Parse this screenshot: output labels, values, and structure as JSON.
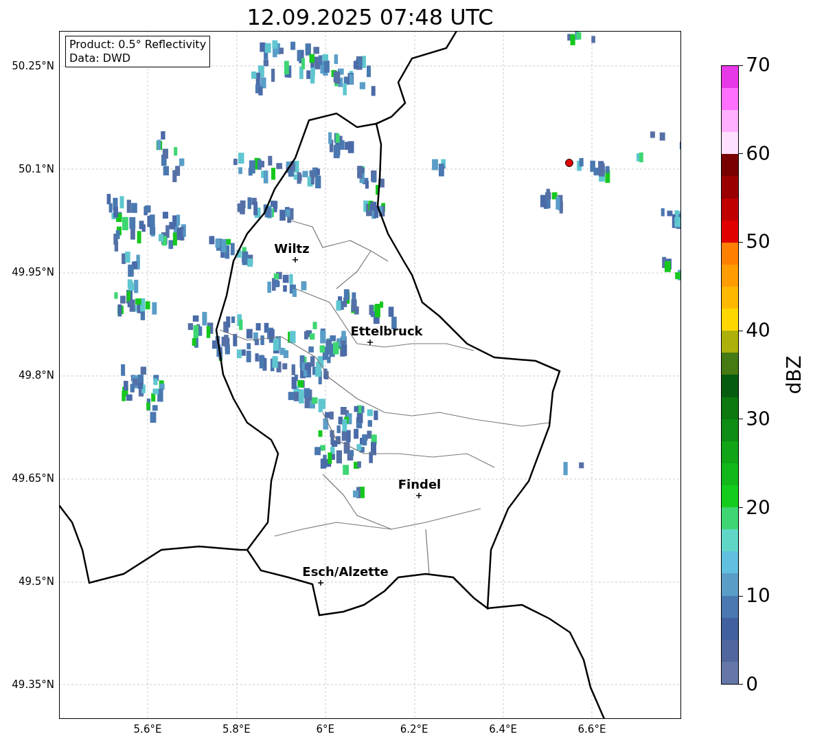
{
  "title": "12.09.2025 07:48 UTC",
  "info_box": {
    "lines": [
      "Product: 0.5° Reflectivity",
      "Data: DWD"
    ]
  },
  "cities": [
    {
      "name": "Wiltz"
    },
    {
      "name": "Ettelbruck"
    },
    {
      "name": "Findel"
    },
    {
      "name": "Esch/Alzette"
    }
  ],
  "lat_ticks": [
    "50.25°N",
    "50.1°N",
    "49.95°N",
    "49.8°N",
    "49.65°N",
    "49.5°N",
    "49.35°N"
  ],
  "lon_ticks": [
    "5.6°E",
    "5.8°E",
    "6°E",
    "6.2°E",
    "6.4°E",
    "6.6°E"
  ],
  "colorbar": {
    "label": "dBZ",
    "ticks": [
      "70",
      "60",
      "50",
      "40",
      "30",
      "20",
      "10",
      "0"
    ],
    "bands": [
      {
        "color": "#6477a8"
      },
      {
        "color": "#51669c"
      },
      {
        "color": "#4260a0"
      },
      {
        "color": "#4a78b0"
      },
      {
        "color": "#5a9ec8"
      },
      {
        "color": "#62c0df"
      },
      {
        "color": "#5fd6c6"
      },
      {
        "color": "#3dd672"
      },
      {
        "color": "#14cc1c"
      },
      {
        "color": "#12b81a"
      },
      {
        "color": "#10a416"
      },
      {
        "color": "#0e8c14"
      },
      {
        "color": "#0b7810"
      },
      {
        "color": "#065c0e"
      },
      {
        "color": "#467a12"
      },
      {
        "color": "#adb00a"
      },
      {
        "color": "#ffd700"
      },
      {
        "color": "#ffb800"
      },
      {
        "color": "#ff9c00"
      },
      {
        "color": "#ff7f00"
      },
      {
        "color": "#e00000"
      },
      {
        "color": "#c00000"
      },
      {
        "color": "#9a0000"
      },
      {
        "color": "#780000"
      },
      {
        "color": "#ffdfff"
      },
      {
        "color": "#ffb0ff"
      },
      {
        "color": "#ff70ff"
      },
      {
        "color": "#e839e8"
      }
    ]
  }
}
